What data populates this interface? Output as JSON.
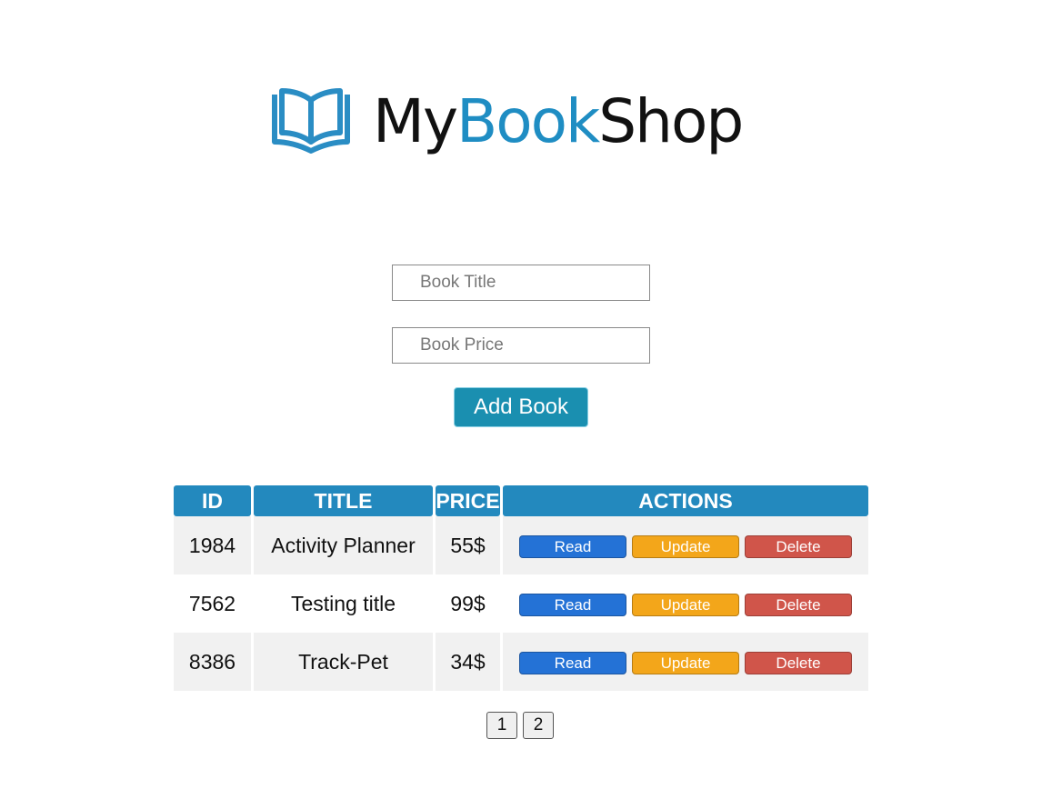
{
  "brand": {
    "logo_icon": "open-book-icon",
    "name_part1": "My",
    "name_part2": "Book",
    "name_part3": "Shop",
    "accent_color": "#1f8dc3"
  },
  "form": {
    "title_placeholder": "Book Title",
    "price_placeholder": "Book Price",
    "add_label": "Add Book"
  },
  "table": {
    "headers": [
      "ID",
      "TITLE",
      "PRICE",
      "ACTIONS"
    ],
    "rows": [
      {
        "id": "1984",
        "title": "Activity Planner",
        "price": "55$"
      },
      {
        "id": "7562",
        "title": "Testing title",
        "price": "99$"
      },
      {
        "id": "8386",
        "title": "Track-Pet",
        "price": "34$"
      }
    ],
    "action_labels": {
      "read": "Read",
      "update": "Update",
      "delete": "Delete"
    }
  },
  "pagination": {
    "pages": [
      "1",
      "2"
    ]
  }
}
